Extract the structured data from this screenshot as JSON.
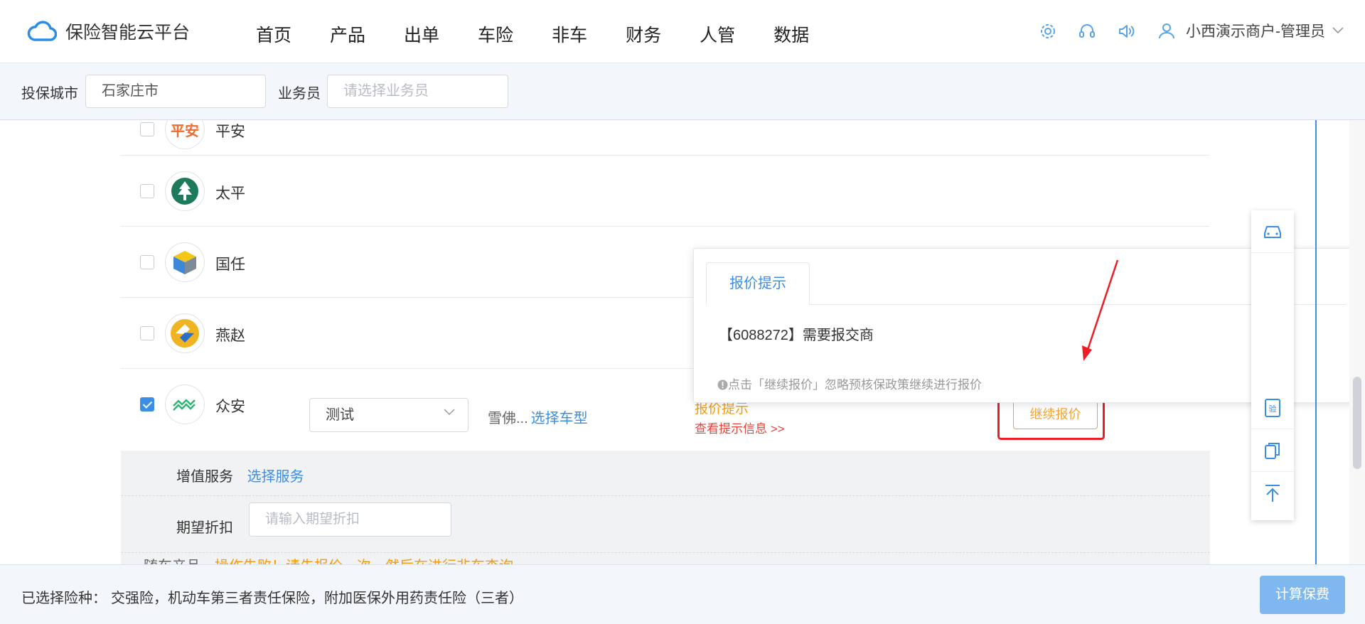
{
  "app": {
    "brand": "保险智能云平台",
    "nav": [
      "首页",
      "产品",
      "出单",
      "车险",
      "非车",
      "财务",
      "人管",
      "数据"
    ],
    "user": "小西演示商户-管理员",
    "toolbar_icons": [
      "settings-icon",
      "headset-icon",
      "speaker-icon",
      "user-icon"
    ]
  },
  "filters": {
    "city_label": "投保城市",
    "city_value": "石家庄市",
    "salesman_label": "业务员",
    "salesman_placeholder": "请选择业务员"
  },
  "companies": [
    {
      "name": "平安",
      "logo_text": "平安",
      "checked": false
    },
    {
      "name": "太平",
      "checked": false
    },
    {
      "name": "国任",
      "checked": false
    },
    {
      "name": "燕赵",
      "checked": false
    },
    {
      "name": "众安",
      "checked": true
    }
  ],
  "selected_row": {
    "plan": "测试",
    "vehicle_text": "雪佛...",
    "select_vehicle": "选择车型",
    "tip_title": "报价提示",
    "tip_link": "查看提示信息 >>",
    "continue_button": "继续报价"
  },
  "services": {
    "label": "增值服务",
    "link": "选择服务"
  },
  "discount": {
    "label": "期望折扣",
    "placeholder": "请输入期望折扣"
  },
  "noncar": {
    "label": "随车产品",
    "warning": "操作失败！请先报价一次，然后在进行非车查询"
  },
  "popover": {
    "tab": "报价提示",
    "message": "【6088272】需要报交商",
    "hint": "点击「继续报价」忽略预核保政策继续进行报价"
  },
  "footer": {
    "selected_label": "已选择险种：",
    "selected_value": "交强险，机动车第三者责任保险，附加医保外用药责任险（三者）",
    "calc_button": "计算保费"
  },
  "colors": {
    "primary": "#3a8ee6",
    "warning": "#f39c12",
    "danger": "#e5453b",
    "annotation": "#ee1c25"
  }
}
